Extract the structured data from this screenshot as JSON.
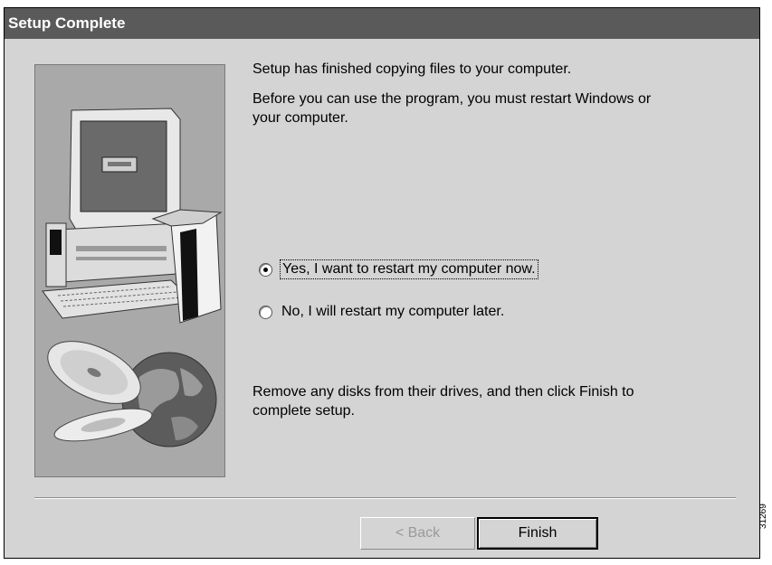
{
  "window": {
    "title": "Setup Complete"
  },
  "messages": {
    "finished": "Setup has finished copying files to your computer.",
    "restart_line1": "Before you can use the program, you must restart Windows or",
    "restart_line2": "your computer.",
    "remove_line1": "Remove any disks from their drives, and then click Finish to",
    "remove_line2": "complete setup."
  },
  "options": [
    {
      "label": "Yes, I want to restart my computer now.",
      "selected": true
    },
    {
      "label": "No, I will restart my computer later.",
      "selected": false
    }
  ],
  "buttons": {
    "back_label": "< Back",
    "finish_label": "Finish"
  },
  "figure_code": "31269",
  "colors": {
    "titlebar": "#5a5a5a",
    "dialog_bg": "#d4d4d4",
    "image_bg": "#a9a9a9"
  },
  "icons": [
    "computer-icon",
    "cd-icon",
    "globe-icon"
  ]
}
